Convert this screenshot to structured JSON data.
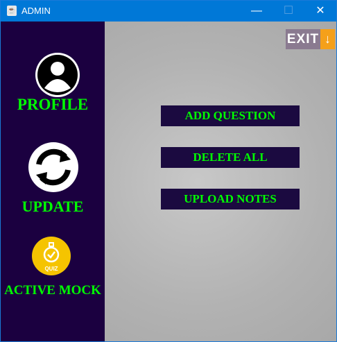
{
  "window": {
    "title": "ADMIN",
    "minimize": "—",
    "maximize": "☐",
    "close": "✕"
  },
  "sidebar": {
    "items": [
      {
        "label": "PROFILE"
      },
      {
        "label": "UPDATE"
      },
      {
        "label": "ACTIVE MOCK"
      }
    ],
    "quiz_badge": "QUIZ"
  },
  "main": {
    "exit_label": "EXIT",
    "exit_arrow": "↓",
    "buttons": [
      {
        "label": "ADD QUESTION"
      },
      {
        "label": "DELETE ALL"
      },
      {
        "label": "UPLOAD NOTES"
      }
    ]
  }
}
